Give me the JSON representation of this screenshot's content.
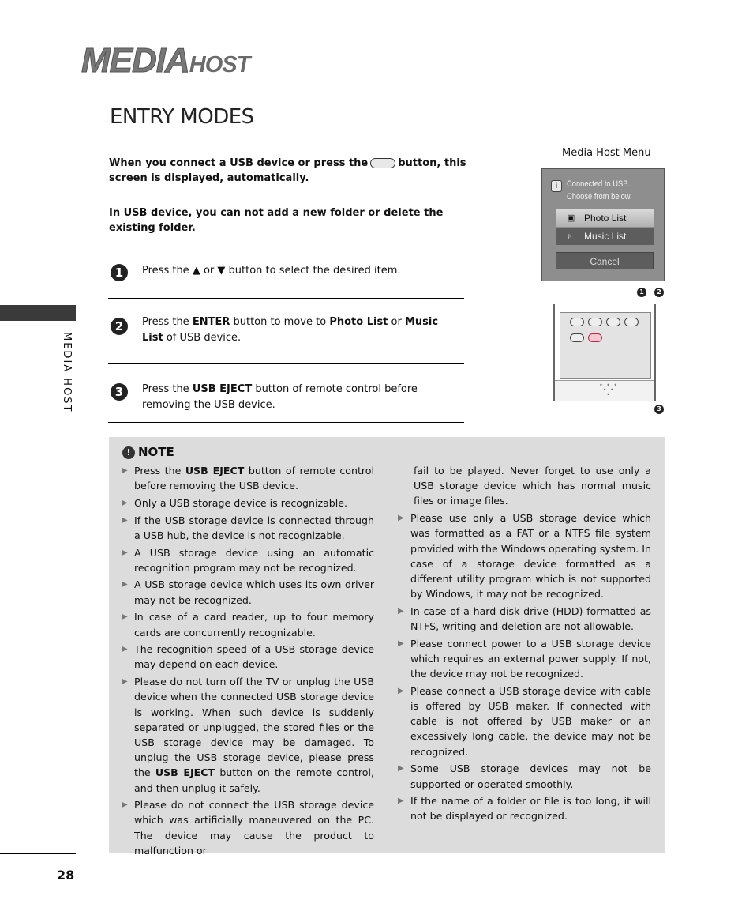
{
  "header": {
    "logo_main": "MEDIA",
    "logo_sub": "HOST",
    "section_title": "ENTRY MODES"
  },
  "intro": {
    "line1_before": "When you connect a USB device or  press the",
    "line1_after": "button, this screen is displayed, automatically.",
    "line2": "In USB device, you can not add a new folder or delete the existing folder."
  },
  "steps": [
    {
      "num": "1",
      "parts": [
        "Press the ",
        "▲",
        " or ",
        "▼",
        " button to select the desired item."
      ]
    },
    {
      "num": "2",
      "parts": [
        "Press the ",
        "ENTER",
        " button to move to ",
        "Photo List",
        " or ",
        "Music List",
        " of USB device."
      ]
    },
    {
      "num": "3",
      "parts": [
        "Press the ",
        "USB EJECT",
        "  button of remote control before removing the USB device."
      ]
    }
  ],
  "sidebar": {
    "label": "MEDIA HOST"
  },
  "media_host_menu": {
    "caption": "Media Host Menu",
    "info_icon": "i",
    "message_line1": "Connected to USB.",
    "message_line2": "Choose from below.",
    "options": [
      {
        "label": "Photo List",
        "icon": "photo-icon",
        "selected": true
      },
      {
        "label": "Music List",
        "icon": "music-note-icon",
        "selected": false
      }
    ],
    "cancel_label": "Cancel",
    "step_refs": [
      "1",
      "2"
    ]
  },
  "remote": {
    "step_ref": "3",
    "highlighted_key": "usb-eject"
  },
  "note": {
    "heading": "NOTE",
    "left_items": [
      {
        "parts": [
          "Press the ",
          "USB EJECT",
          "  button of remote control before removing the USB device."
        ]
      },
      {
        "text": "Only a USB storage device is recognizable."
      },
      {
        "text": "If the USB storage device is connected through a USB hub, the device is not recognizable."
      },
      {
        "text": "A USB storage device using an automatic recognition program may not be recognized."
      },
      {
        "text": "A USB storage device which uses its own driver may not be recognized."
      },
      {
        "text": "In case of a card reader, up to four memory cards are concurrently recognizable."
      },
      {
        "text": "The recognition speed of a USB storage device may depend on each device."
      },
      {
        "parts": [
          "Please do not turn off the TV or unplug the USB device when the connected USB storage device is working.  When such device is suddenly separated or unplugged, the stored files or the USB storage device may be damaged.  To unplug the USB storage device, please press the ",
          "USB EJECT",
          " button on the remote control, and then unplug it safely."
        ]
      },
      {
        "text": "Please do not connect the USB storage device which was artificially maneuvered on the PC.  The device may cause the product to malfunction or"
      }
    ],
    "right_continuation": "fail to be played.  Never forget to use only a USB storage device which has normal music files or image files.",
    "right_items": [
      {
        "text": "Please use only a USB storage device which was formatted as a FAT or a NTFS file system provided with the Windows operating system.  In case of a storage device formatted as a different utility program which is not supported by Windows, it may not be recognized."
      },
      {
        "text": "In case of a hard disk drive (HDD) formatted as NTFS, writing and deletion are not allowable."
      },
      {
        "text": "Please connect power to a USB storage device which requires an external power supply.  If not, the device may not be recognized."
      },
      {
        "text": "Please connect a USB storage device with cable is offered by USB maker.  If connected with cable is not offered by USB maker or an excessively long cable, the device may not be recognized."
      },
      {
        "text": "Some USB storage devices may not be supported or operated smoothly."
      },
      {
        "text": "If the name of a folder or file is too long, it will not be displayed or recognized."
      }
    ]
  },
  "footer": {
    "page_number": "28"
  },
  "colors": {
    "note_bg": "#dcdcdc",
    "sidebar_bar": "#3a3a3a",
    "eject_key": "#c4244a"
  }
}
